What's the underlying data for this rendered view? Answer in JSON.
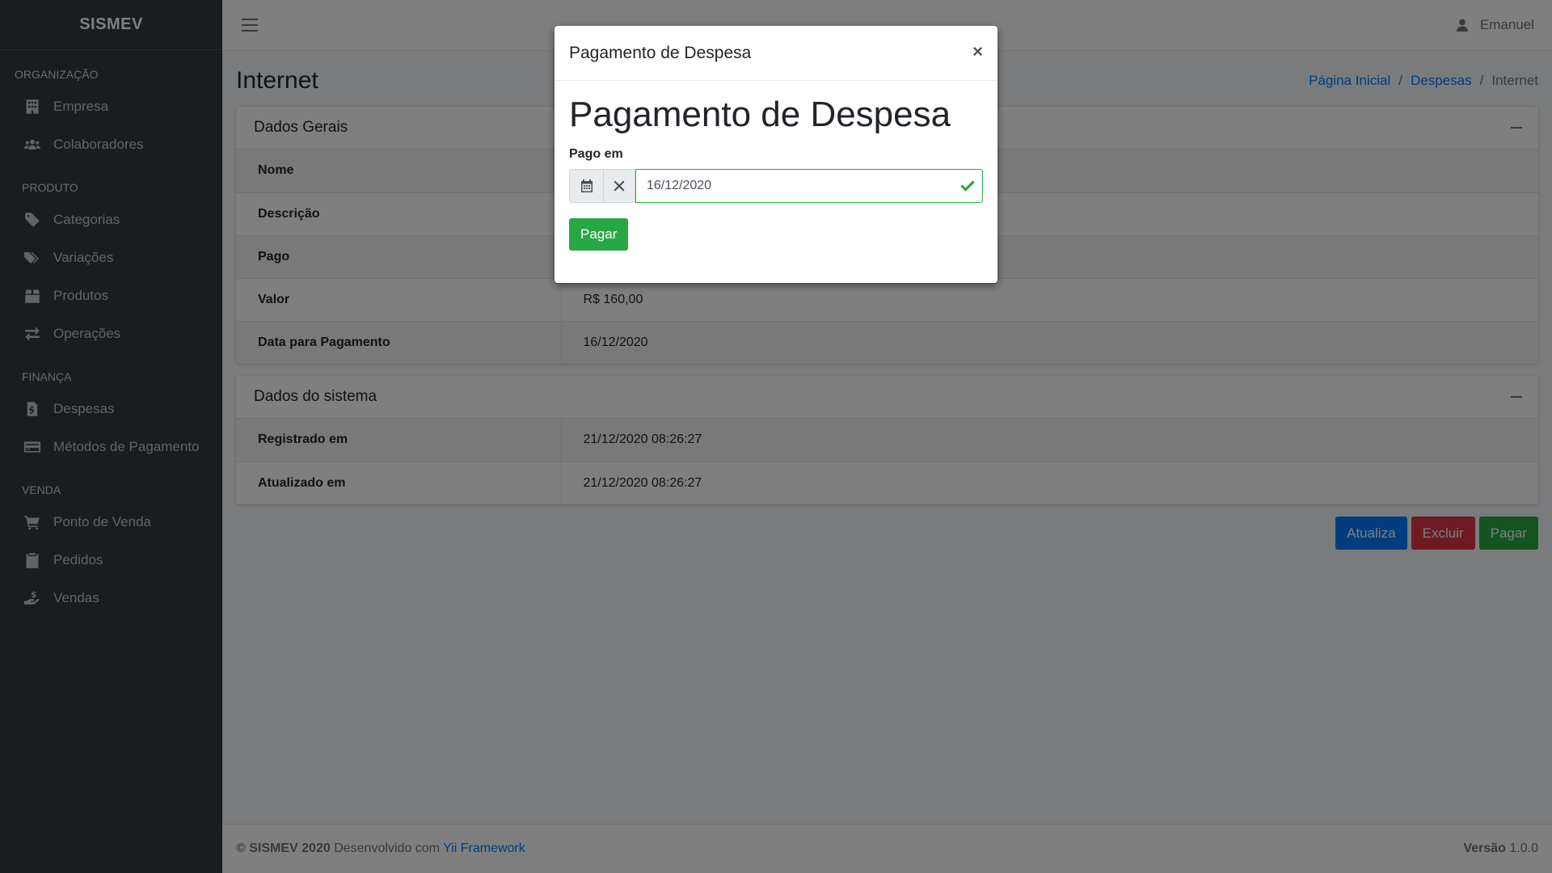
{
  "brand": "SISMEV",
  "sidebar": {
    "sections": [
      {
        "header": "Organização",
        "items": [
          {
            "label": "Empresa",
            "icon": "building-icon"
          },
          {
            "label": "Colaboradores",
            "icon": "users-icon"
          }
        ]
      },
      {
        "header": "Produto",
        "items": [
          {
            "label": "Categorias",
            "icon": "tag-icon"
          },
          {
            "label": "Variações",
            "icon": "tags-icon"
          },
          {
            "label": "Produtos",
            "icon": "box-icon"
          },
          {
            "label": "Operações",
            "icon": "exchange-icon"
          }
        ]
      },
      {
        "header": "Finança",
        "items": [
          {
            "label": "Despesas",
            "icon": "invoice-icon"
          },
          {
            "label": "Métodos de Pagamento",
            "icon": "credit-card-icon"
          }
        ]
      },
      {
        "header": "Venda",
        "items": [
          {
            "label": "Ponto de Venda",
            "icon": "cart-icon"
          },
          {
            "label": "Pedidos",
            "icon": "clipboard-icon"
          },
          {
            "label": "Vendas",
            "icon": "hand-dollar-icon"
          }
        ]
      }
    ]
  },
  "topbar": {
    "user": "Emanuel"
  },
  "page": {
    "title": "Internet",
    "breadcrumb": {
      "home": "Página Inicial",
      "parent": "Despesas",
      "current": "Internet",
      "separator": "/"
    }
  },
  "general_card": {
    "title": "Dados Gerais",
    "rows": [
      {
        "key": "Nome",
        "value": ""
      },
      {
        "key": "Descrição",
        "value": ""
      },
      {
        "key": "Pago",
        "value": ""
      },
      {
        "key": "Valor",
        "value": "R$ 160,00"
      },
      {
        "key": "Data para Pagamento",
        "value": "16/12/2020"
      }
    ]
  },
  "system_card": {
    "title": "Dados do sistema",
    "rows": [
      {
        "key": "Registrado em",
        "value": "21/12/2020 08:26:27"
      },
      {
        "key": "Atualizado em",
        "value": "21/12/2020 08:26:27"
      }
    ]
  },
  "actions": {
    "update": "Atualiza",
    "delete": "Excluir",
    "pay": "Pagar"
  },
  "footer": {
    "copyright": "© SISMEV 2020",
    "developed": "Desenvolvido com",
    "framework": "Yii Framework",
    "version_label": "Versão",
    "version": "1.0.0"
  },
  "modal": {
    "title": "Pagamento de Despesa",
    "close": "×",
    "heading": "Pagamento de Despesa",
    "field_label": "Pago em",
    "date_value": "16/12/2020",
    "submit": "Pagar"
  },
  "colors": {
    "sidebar": "#343a40",
    "primary": "#007bff",
    "danger": "#dc3545",
    "success": "#28a745"
  }
}
